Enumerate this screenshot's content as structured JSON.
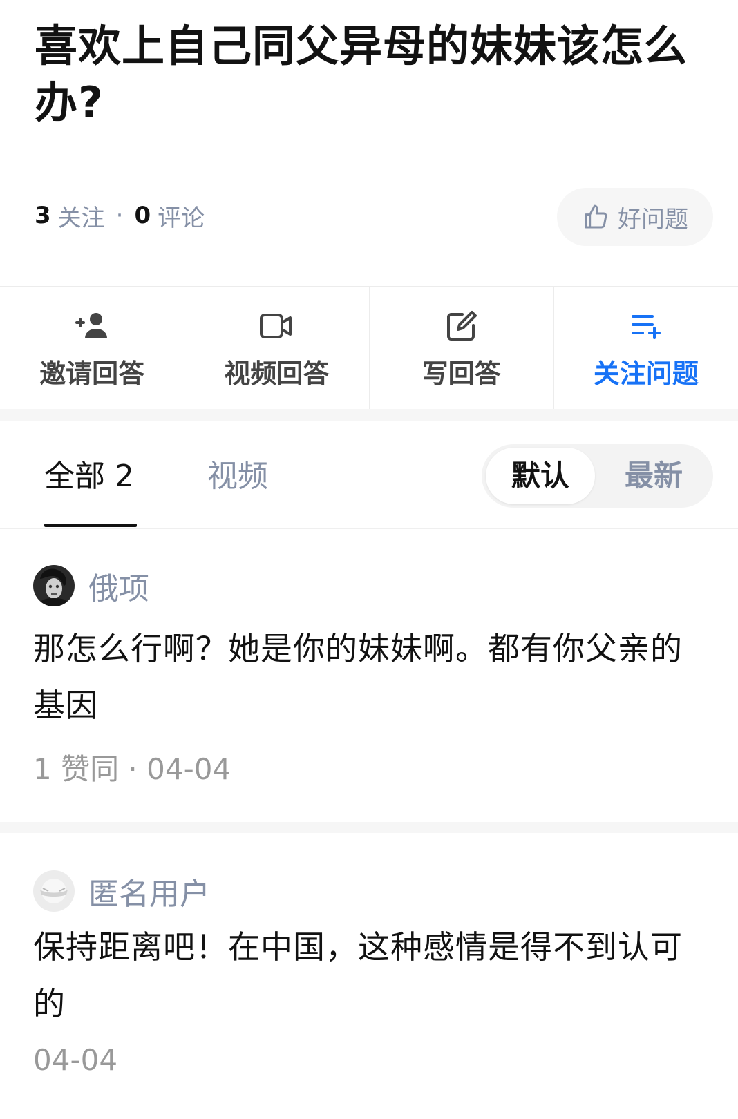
{
  "question": {
    "title": "喜欢上自己同父异母的妹妹该怎么办?",
    "follow_count": "3",
    "follow_label": "关注",
    "separator": "·",
    "comment_count": "0",
    "comment_label": "评论",
    "good_question_label": "好问题"
  },
  "actions": [
    {
      "label": "邀请回答",
      "icon": "add-user-icon"
    },
    {
      "label": "视频回答",
      "icon": "video-camera-icon"
    },
    {
      "label": "写回答",
      "icon": "edit-icon"
    },
    {
      "label": "关注问题",
      "icon": "add-list-icon",
      "active": true
    }
  ],
  "tabs": {
    "all_label": "全部 2",
    "video_label": "视频"
  },
  "sort": {
    "default_label": "默认",
    "latest_label": "最新",
    "selected": "默认"
  },
  "answers": [
    {
      "author": "俄项",
      "text": "那怎么行啊？她是你的妹妹啊。都有你父亲的基因",
      "meta": "1 赞同 · 04-04"
    },
    {
      "author": "匿名用户",
      "text": "保持距离吧！在中国，这种感情是得不到认可的",
      "meta": "04-04"
    }
  ],
  "colors": {
    "accent": "#1772f6",
    "text_primary": "#121212",
    "text_secondary": "#8590a6",
    "band": "#f6f6f6"
  }
}
